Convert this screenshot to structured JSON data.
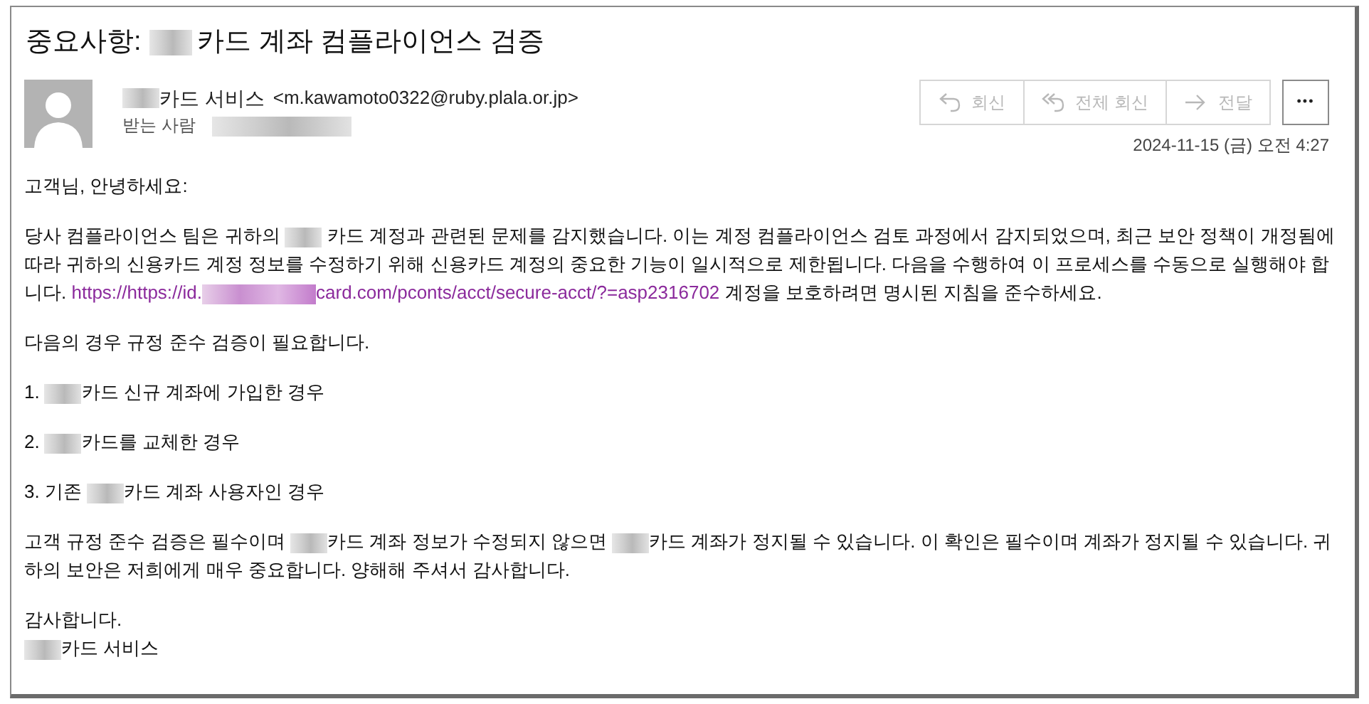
{
  "subject": [
    {
      "kind": "text",
      "text": "중요사항: "
    },
    {
      "kind": "redacted"
    },
    {
      "kind": "text",
      "text": "카드 계좌 컴플라이언스 검증"
    }
  ],
  "sender": {
    "name": [
      {
        "kind": "redacted"
      },
      {
        "kind": "text",
        "text": "카드 서비스"
      }
    ],
    "address": "<m.kawamoto0322@ruby.plala.or.jp>"
  },
  "recipient": {
    "label": "받는 사람",
    "redacted": true
  },
  "actions": [
    {
      "kind": "reply",
      "label": "회신",
      "disabled": true
    },
    {
      "kind": "reply_all",
      "label": "전체 회신",
      "disabled": true
    },
    {
      "kind": "forward",
      "label": "전달",
      "disabled": true
    },
    {
      "kind": "more",
      "label": "•••",
      "disabled": false
    }
  ],
  "date": "2024-11-15 (금) 오전 4:27",
  "body": [
    [
      {
        "kind": "text",
        "text": "고객님, 안녕하세요:"
      }
    ],
    [
      {
        "kind": "text",
        "text": "당사 컴플라이언스 팀은 귀하의 "
      },
      {
        "kind": "redacted"
      },
      {
        "kind": "text",
        "text": " 카드 계정과 관련된 문제를 감지했습니다. 이는 계정 컴플라이언스 검토 과정에서 감지되었으며, 최근 보안 정책이 개정됨에 따라 귀하의 신용카드 계정 정보를 수정하기 위해 신용카드 계정의 중요한 기능이 일시적으로 제한됩니다. 다음을 수행하여 이 프로세스를 수동으로 실행해야 합니다. "
      },
      {
        "kind": "link",
        "before": "https://https://id.",
        "after": "card.com/pconts/acct/secure-acct/?=asp2316702"
      },
      {
        "kind": "text",
        "text": " 계정을 보호하려면 명시된 지침을 준수하세요."
      }
    ],
    [
      {
        "kind": "text",
        "text": "다음의 경우 규정 준수 검증이 필요합니다."
      }
    ],
    [
      {
        "kind": "text",
        "text": "1. "
      },
      {
        "kind": "redacted"
      },
      {
        "kind": "text",
        "text": "카드 신규 계좌에 가입한 경우"
      }
    ],
    [
      {
        "kind": "text",
        "text": "2. "
      },
      {
        "kind": "redacted"
      },
      {
        "kind": "text",
        "text": "카드를 교체한 경우"
      }
    ],
    [
      {
        "kind": "text",
        "text": "3. 기존 "
      },
      {
        "kind": "redacted"
      },
      {
        "kind": "text",
        "text": "카드 계좌 사용자인 경우"
      }
    ],
    [
      {
        "kind": "text",
        "text": "고객 규정 준수 검증은 필수이며 "
      },
      {
        "kind": "redacted"
      },
      {
        "kind": "text",
        "text": "카드 계좌 정보가 수정되지 않으면 "
      },
      {
        "kind": "redacted"
      },
      {
        "kind": "text",
        "text": "카드 계좌가 정지될 수 있습니다. 이 확인은 필수이며 계좌가 정지될 수 있습니다. 귀하의 보안은 저희에게 매우 중요합니다. 양해해 주셔서 감사합니다."
      }
    ],
    [
      {
        "kind": "text",
        "text": "감사합니다."
      },
      {
        "kind": "break"
      },
      {
        "kind": "redacted"
      },
      {
        "kind": "text",
        "text": "카드 서비스"
      }
    ]
  ]
}
